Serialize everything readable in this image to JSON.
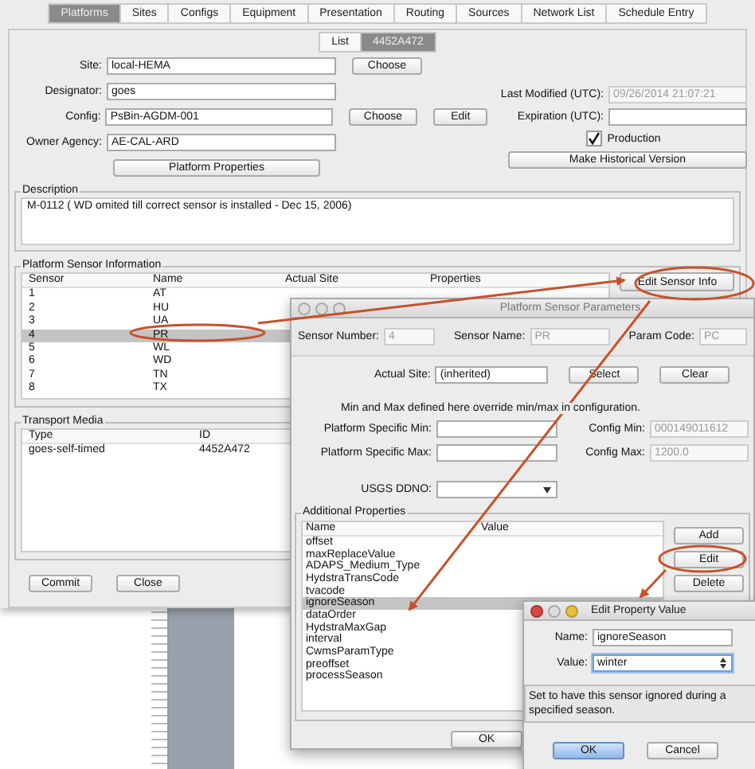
{
  "main_window": {
    "tabs": [
      {
        "label": "Platforms",
        "selected": true
      },
      {
        "label": "Sites",
        "selected": false
      },
      {
        "label": "Configs",
        "selected": false
      },
      {
        "label": "Equipment",
        "selected": false
      },
      {
        "label": "Presentation",
        "selected": false
      },
      {
        "label": "Routing",
        "selected": false
      },
      {
        "label": "Sources",
        "selected": false
      },
      {
        "label": "Network List",
        "selected": false
      },
      {
        "label": "Schedule Entry",
        "selected": false
      }
    ],
    "subtabs": [
      {
        "label": "List",
        "selected": false
      },
      {
        "label": "4452A472",
        "selected": true
      }
    ],
    "left_fields": [
      {
        "label": "Site:",
        "value": "local-HEMA",
        "buttons": [
          "Choose"
        ]
      },
      {
        "label": "Designator:",
        "value": "goes"
      },
      {
        "label": "Config:",
        "value": "PsBin-AGDM-001",
        "buttons": [
          "Choose",
          "Edit"
        ]
      },
      {
        "label": "Owner Agency:",
        "value": "AE-CAL-ARD"
      }
    ],
    "platform_properties_button": "Platform Properties",
    "right_fields": [
      {
        "label": "Last Modified (UTC):",
        "value": "09/26/2014 21:07:21",
        "disabled": true
      },
      {
        "label": "Expiration (UTC):",
        "disabled": false
      }
    ],
    "production": {
      "label": "Production",
      "checked": true
    },
    "historical_button": "Make Historical Version",
    "description": {
      "title": "Description",
      "text": "M-0112 ( WD omited till correct sensor is installed - Dec 15, 2006)"
    },
    "sensor_info": {
      "title": "Platform Sensor Information",
      "columns": [
        "Sensor",
        "Name",
        "Actual Site",
        "Properties"
      ],
      "button": "Edit Sensor Info",
      "rows": [
        {
          "cells": [
            "1",
            "AT"
          ],
          "selected": false
        },
        {
          "cells": [
            "2",
            "HU"
          ],
          "selected": false
        },
        {
          "cells": [
            "3",
            "UA"
          ],
          "selected": false
        },
        {
          "cells": [
            "4",
            "PR"
          ],
          "selected": true
        },
        {
          "cells": [
            "5",
            "WL"
          ],
          "selected": false
        },
        {
          "cells": [
            "6",
            "WD"
          ],
          "selected": false
        },
        {
          "cells": [
            "7",
            "TN"
          ],
          "selected": false
        },
        {
          "cells": [
            "8",
            "TX"
          ],
          "selected": false
        }
      ]
    },
    "transport_media": {
      "title": "Transport Media",
      "columns": [
        "Type",
        "ID"
      ],
      "rows": [
        {
          "cells": [
            "goes-self-timed",
            "4452A472"
          ]
        }
      ]
    },
    "buttons": [
      "Commit",
      "Close"
    ]
  },
  "sensor_dialog": {
    "title": "Platform Sensor Parameters",
    "id_fields": [
      {
        "label": "Sensor Number:",
        "value": "4",
        "disabled": true
      },
      {
        "label": "Sensor Name:",
        "value": "PR",
        "disabled": true
      },
      {
        "label": "Param Code:",
        "value": "PC",
        "disabled": true
      }
    ],
    "actual_site": {
      "label": "Actual Site:",
      "value": "(inherited)",
      "buttons": [
        "Select",
        "Clear"
      ]
    },
    "note": "Min and Max defined here override min/max in configuration.",
    "limits": [
      {
        "label": "Platform Specific Min:",
        "config_label": "Config Min:",
        "config_value": "000149011612",
        "disabled": true
      },
      {
        "label": "Platform Specific Max:",
        "config_label": "Config Max:",
        "config_value": "1200.0",
        "disabled": true
      }
    ],
    "usgs": {
      "label": "USGS DDNO:"
    },
    "properties": {
      "title": "Additional Properties",
      "columns": [
        "Name",
        "Value"
      ],
      "buttons": [
        "Add",
        "Edit",
        "Delete"
      ],
      "rows": [
        {
          "name": "offset",
          "selected": false
        },
        {
          "name": "maxReplaceValue",
          "selected": false
        },
        {
          "name": "ADAPS_Medium_Type",
          "selected": false
        },
        {
          "name": "HydstraTransCode",
          "selected": false
        },
        {
          "name": "tvacode",
          "selected": false
        },
        {
          "name": "ignoreSeason",
          "selected": true
        },
        {
          "name": "dataOrder",
          "selected": false
        },
        {
          "name": "HydstraMaxGap",
          "selected": false
        },
        {
          "name": "interval",
          "selected": false
        },
        {
          "name": "CwmsParamType",
          "selected": false
        },
        {
          "name": "preoffset",
          "selected": false
        },
        {
          "name": "processSeason",
          "selected": false
        }
      ]
    },
    "ok": "OK"
  },
  "edit_dialog": {
    "title": "Edit Property Value",
    "name": {
      "label": "Name:",
      "value": "ignoreSeason"
    },
    "value": {
      "label": "Value:",
      "value": "winter"
    },
    "help": "Set to have this sensor ignored during a specified season.",
    "buttons": [
      {
        "label": "OK",
        "default": true
      },
      {
        "label": "Cancel",
        "default": false
      }
    ]
  }
}
